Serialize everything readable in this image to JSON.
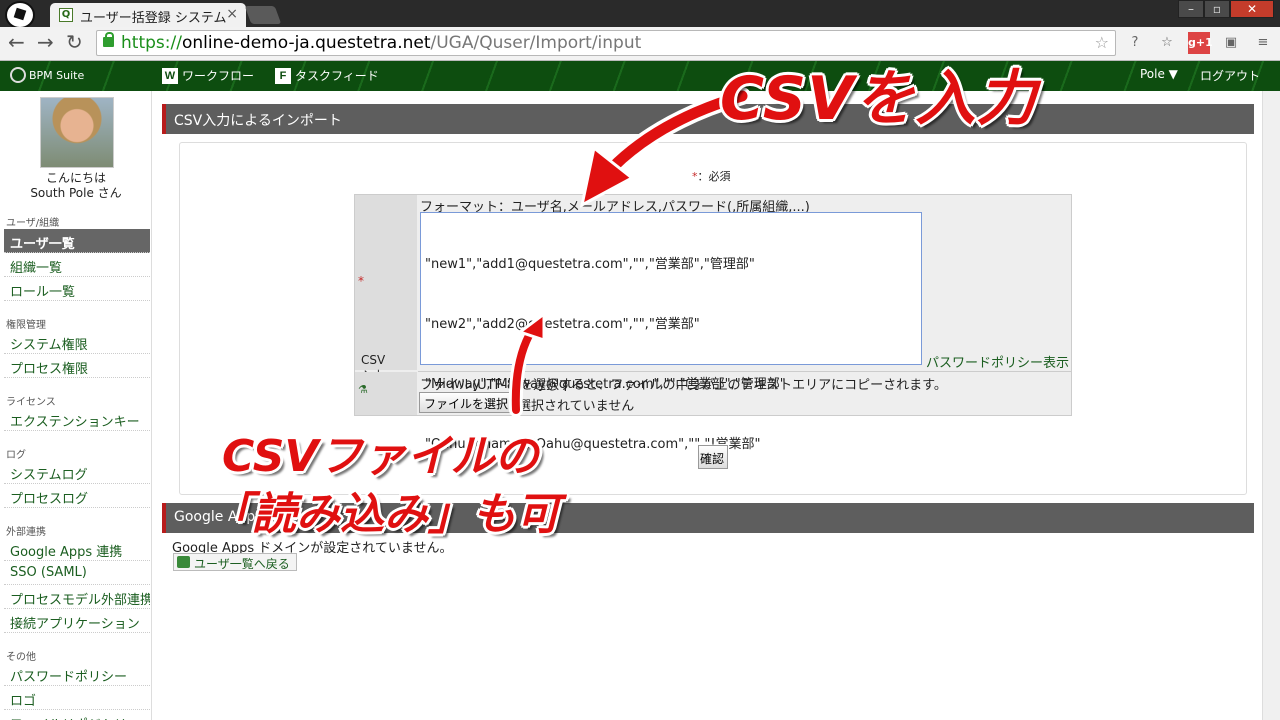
{
  "browser": {
    "tab_title": "ユーザー括登録 システム",
    "url_scheme": "https://",
    "url_host": "online-demo-ja.questetra.net",
    "url_path": "/UGA/Quser/Import/input"
  },
  "header": {
    "logo": "BPM Suite",
    "nav_workflow": "ワークフロー",
    "nav_feed": "タスクフィード",
    "user_menu": "Pole ▼",
    "logout": "ログアウト"
  },
  "sidebar": {
    "greeting_line1": "こんにちは",
    "greeting_line2": "South Pole さん",
    "sections": [
      {
        "title": "ユーザ/組織",
        "items": [
          "ユーザ一覧",
          "組織一覧",
          "ロール一覧"
        ]
      },
      {
        "title": "権限管理",
        "items": [
          "システム権限",
          "プロセス権限"
        ]
      },
      {
        "title": "ライセンス",
        "items": [
          "エクステンションキー"
        ]
      },
      {
        "title": "ログ",
        "items": [
          "システムログ",
          "プロセスログ"
        ]
      },
      {
        "title": "外部連携",
        "items": [
          "Google Apps 連携",
          "SSO (SAML)",
          "プロセスモデル外部連携",
          "接続アプリケーション"
        ]
      },
      {
        "title": "その他",
        "items": [
          "パスワードポリシー",
          "ロゴ",
          "ファイルリポジトリ"
        ]
      }
    ]
  },
  "main": {
    "panel_title": "CSV入力によるインポート",
    "required_mark": "*",
    "required_label": "：必須",
    "csv_label": "CSV入力",
    "format_text": "フォーマット：ユーザ名,メールアドレス,パスワード(,所属組織,...)",
    "csv_lines": [
      "\"new1\",\"add1@questetra.com\",\"\",\"営業部\",\"管理部\"",
      "\"new2\",\"add2@questetra.com\",\"\",\"営業部\"",
      "\"Midway\",\"Midway@questetra.com\",\"\",\"営業部\",\"管理部\"",
      "\"Oahu rename\",\"Oahu@questetra.com\",\"\",\"!営業部\""
    ],
    "password_policy_link": "パスワードポリシー表示",
    "file_note": "ファイル(UTF-8)を選択すると、ファイルの中身が上のテキストエリアにコピーされます。",
    "file_button": "ファイルを選択",
    "file_none": "選択されていません",
    "confirm_button": "確認",
    "google_panel_title": "Google Apps",
    "google_message": "Google Apps ドメインが設定されていません。",
    "back_button": "ユーザ一覧へ戻る"
  },
  "annotations": {
    "callout_top": "CSVを入力",
    "callout_bottom_1": "CSVファイルの",
    "callout_bottom_2": "「読み込み」も可"
  },
  "colors": {
    "accent_red": "#e01010",
    "header_green": "#0d4d0f",
    "link_green": "#1b5e20"
  }
}
